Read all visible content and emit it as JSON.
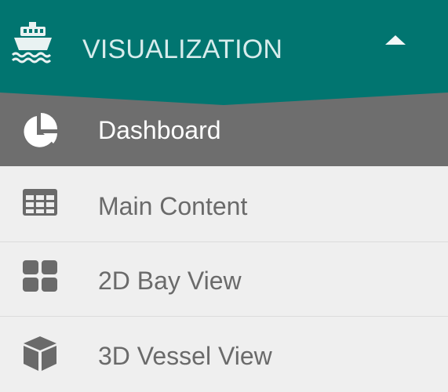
{
  "header": {
    "title": "VISUALIZATION",
    "icon": "ship-icon",
    "toggle_icon": "caret-up-icon",
    "color": "#017570"
  },
  "items": [
    {
      "label": "Dashboard",
      "icon": "pie-chart-icon",
      "active": true
    },
    {
      "label": "Main Content",
      "icon": "table-icon",
      "active": false
    },
    {
      "label": "2D Bay View",
      "icon": "grid-icon",
      "active": false
    },
    {
      "label": "3D Vessel View",
      "icon": "cube-icon",
      "active": false
    }
  ],
  "colors": {
    "active_bg": "#6e6e6e",
    "item_bg": "#efefef",
    "item_text": "#6a6a6a",
    "active_text": "#ffffff"
  }
}
